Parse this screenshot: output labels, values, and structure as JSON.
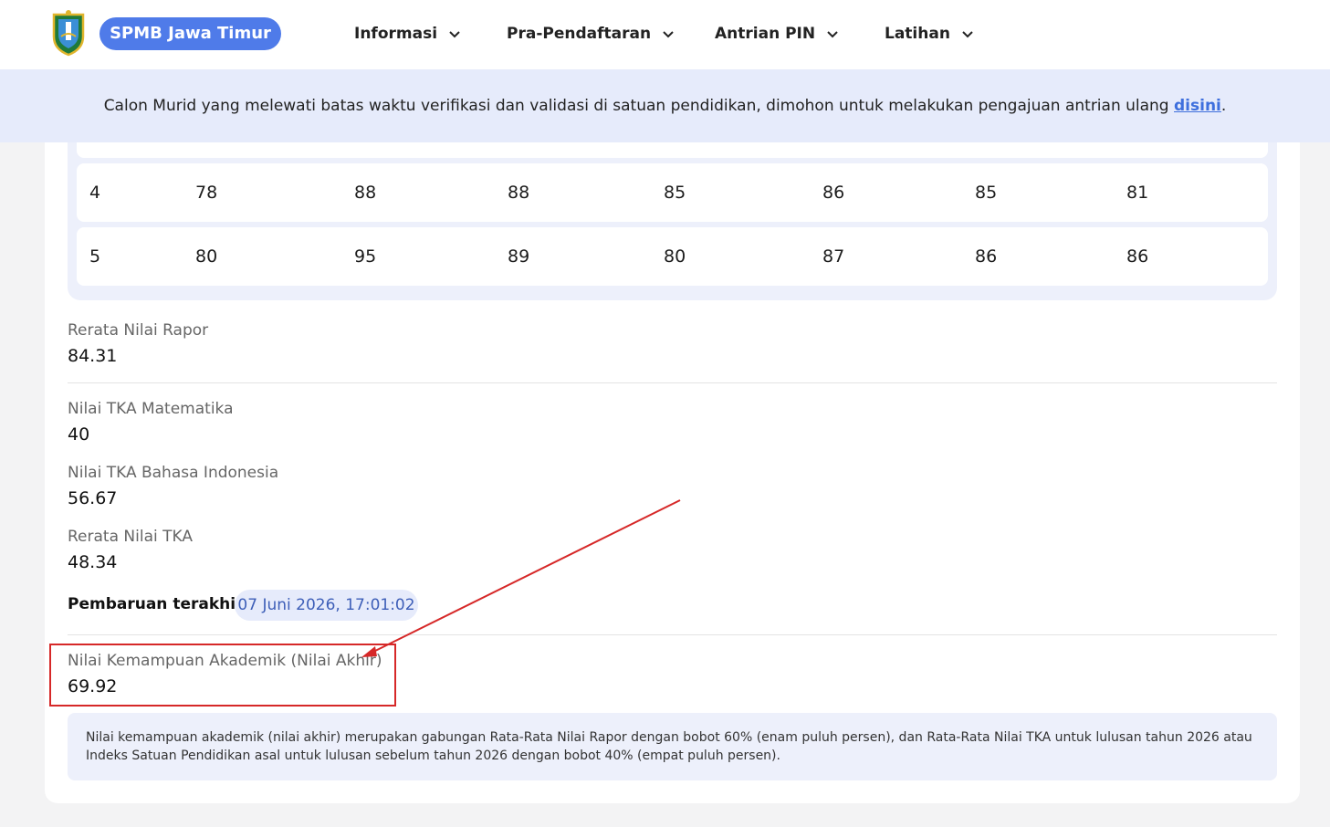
{
  "header": {
    "brand": "SPMB Jawa Timur",
    "nav": [
      {
        "label": "Informasi"
      },
      {
        "label": "Pra-Pendaftaran"
      },
      {
        "label": "Antrian PIN"
      },
      {
        "label": "Latihan"
      }
    ]
  },
  "banner": {
    "text": "Calon Murid yang melewati batas waktu verifikasi dan validasi di satuan pendidikan, dimohon untuk melakukan pengajuan antrian ulang ",
    "link": "disini",
    "suffix": "."
  },
  "grades": {
    "rows": [
      [
        "4",
        "78",
        "88",
        "88",
        "85",
        "86",
        "85",
        "81"
      ],
      [
        "5",
        "80",
        "95",
        "89",
        "80",
        "87",
        "86",
        "86"
      ]
    ]
  },
  "fields": {
    "rerata_rapor": {
      "label": "Rerata Nilai Rapor",
      "value": "84.31"
    },
    "tka_mat": {
      "label": "Nilai TKA Matematika",
      "value": "40"
    },
    "tka_bind": {
      "label": "Nilai TKA Bahasa Indonesia",
      "value": "56.67"
    },
    "rerata_tka": {
      "label": "Rerata Nilai TKA",
      "value": "48.34"
    },
    "pembaruan": {
      "label": "Pembaruan terakhir :",
      "value": "07 Juni 2026, 17:01:02"
    },
    "nilai_akhir": {
      "label": "Nilai Kemampuan Akademik (Nilai Akhir)",
      "value": "69.92"
    }
  },
  "note": "Nilai kemampuan akademik (nilai akhir) merupakan gabungan Rata-Rata Nilai Rapor dengan bobot 60% (enam puluh persen), dan Rata-Rata Nilai TKA untuk lulusan tahun 2026 atau Indeks Satuan Pendidikan asal untuk lulusan sebelum tahun 2026 dengan bobot 40% (empat puluh persen).",
  "colors": {
    "accent": "#4f7be9",
    "annotation": "#d62828",
    "banner_bg": "#e6ebfb"
  },
  "icons": {
    "logo": "east-java-crest-icon",
    "dropdown": "chevron-down-icon"
  }
}
